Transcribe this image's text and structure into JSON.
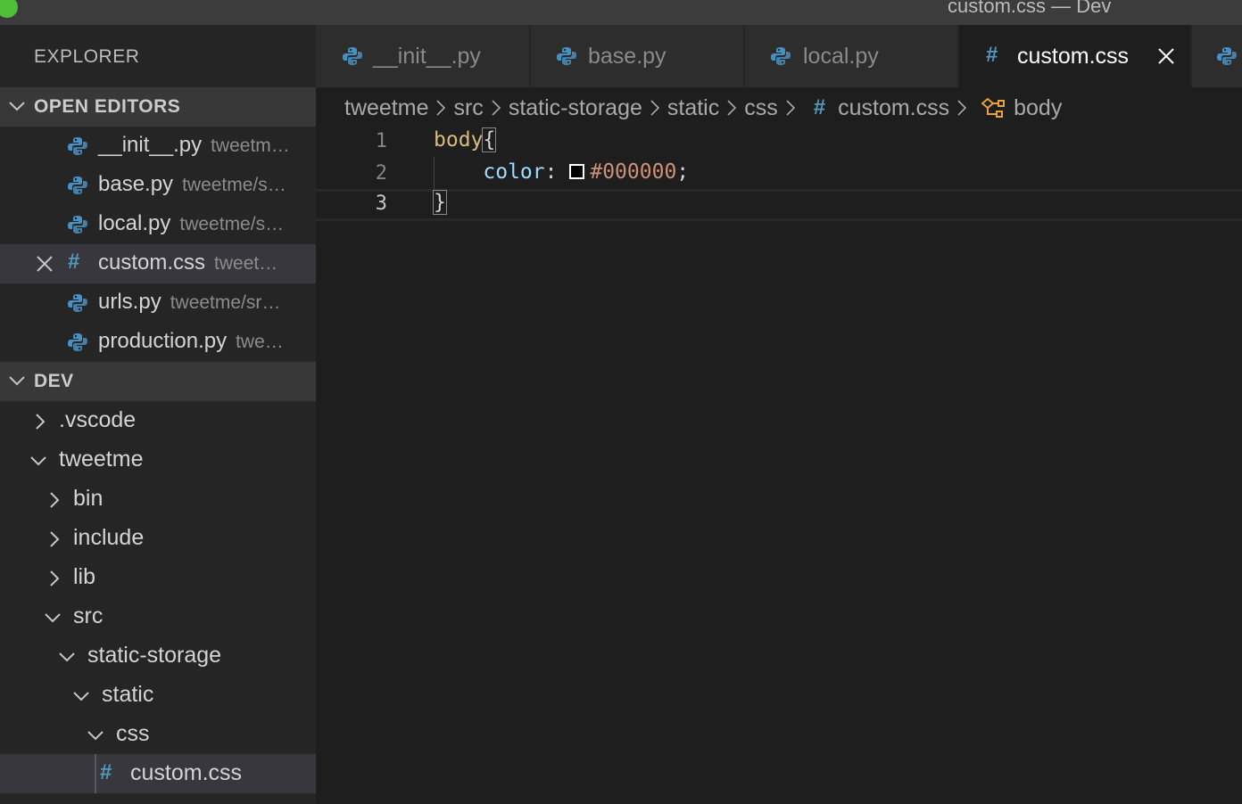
{
  "window": {
    "title": "custom.css — Dev"
  },
  "colors": {
    "python_icon": "#4a8fc1",
    "css_hash": "#519aba",
    "selector": "#d7ba7d",
    "property": "#9cdcfe",
    "value": "#ce9178",
    "accent_symbol": "#e6a23c"
  },
  "tabs": [
    {
      "label": "__init__.py",
      "icon": "python-icon"
    },
    {
      "label": "base.py",
      "icon": "python-icon"
    },
    {
      "label": "local.py",
      "icon": "python-icon"
    },
    {
      "label": "custom.css",
      "icon": "css-hash-icon",
      "active": true
    }
  ],
  "breadcrumb": {
    "parts": [
      "tweetme",
      "src",
      "static-storage",
      "static",
      "css"
    ],
    "file": "custom.css",
    "symbol": "body"
  },
  "sidebar": {
    "title": "EXPLORER",
    "open_editors": {
      "header": "OPEN EDITORS",
      "items": [
        {
          "name": "__init__.py",
          "path": "tweetm…"
        },
        {
          "name": "base.py",
          "path": "tweetme/s…"
        },
        {
          "name": "local.py",
          "path": "tweetme/s…"
        },
        {
          "name": "custom.css",
          "path": "tweet…",
          "active": true
        },
        {
          "name": "urls.py",
          "path": "tweetme/sr…"
        },
        {
          "name": "production.py",
          "path": "twe…"
        }
      ]
    },
    "workspace": {
      "header": "DEV",
      "items": [
        {
          "label": ".vscode"
        },
        {
          "label": "tweetme"
        },
        {
          "label": "bin"
        },
        {
          "label": "include"
        },
        {
          "label": "lib"
        },
        {
          "label": "src"
        },
        {
          "label": "static-storage"
        },
        {
          "label": "static"
        },
        {
          "label": "css"
        },
        {
          "label": "custom.css"
        }
      ]
    }
  },
  "editor": {
    "line_numbers": [
      "1",
      "2",
      "3"
    ],
    "code": {
      "selector": "body",
      "open_brace": "{",
      "property": "color",
      "colon": ":",
      "value": "#000000",
      "semicolon": ";",
      "close_brace": "}"
    }
  }
}
